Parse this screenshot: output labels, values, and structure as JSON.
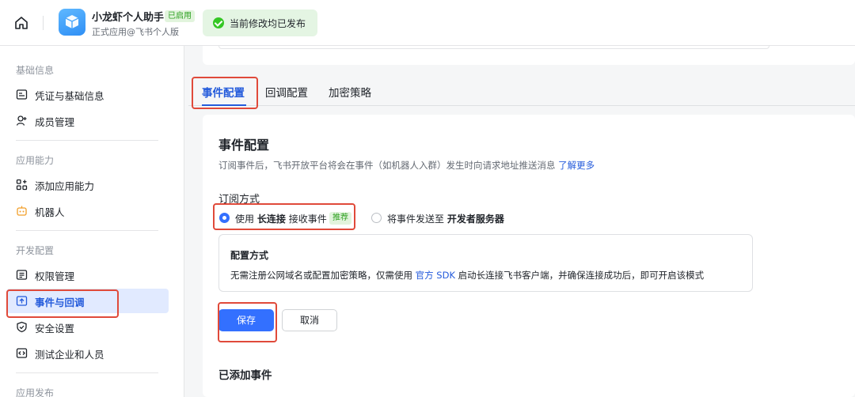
{
  "header": {
    "app_name": "小龙虾个人助手",
    "app_tag": "已启用",
    "app_subtitle": "正式应用@飞书个人版",
    "toast": "当前修改均已发布"
  },
  "sidebar": {
    "groups": [
      {
        "title": "基础信息",
        "items": [
          {
            "label": "凭证与基础信息"
          },
          {
            "label": "成员管理"
          }
        ]
      },
      {
        "title": "应用能力",
        "items": [
          {
            "label": "添加应用能力"
          },
          {
            "label": "机器人"
          }
        ]
      },
      {
        "title": "开发配置",
        "items": [
          {
            "label": "权限管理"
          },
          {
            "label": "事件与回调"
          },
          {
            "label": "安全设置"
          },
          {
            "label": "测试企业和人员"
          }
        ]
      },
      {
        "title": "应用发布",
        "items": []
      }
    ],
    "active_item": "事件与回调"
  },
  "tabs": [
    {
      "label": "事件配置",
      "active": true
    },
    {
      "label": "回调配置",
      "active": false
    },
    {
      "label": "加密策略",
      "active": false
    }
  ],
  "event_config": {
    "title": "事件配置",
    "description": "订阅事件后，飞书开放平台将会在事件（如机器人入群）发生时向请求地址推送消息",
    "learn_more": "了解更多",
    "subscribe_title": "订阅方式",
    "option1": {
      "prefix": "使用",
      "bold": "长连接",
      "suffix": "接收事件",
      "badge": "推荐",
      "checked": true
    },
    "option2": {
      "prefix": "将事件发送至",
      "bold": "开发者服务器",
      "checked": false
    },
    "mode_title": "配置方式",
    "mode_desc_prefix": "无需注册公网域名或配置加密策略，仅需使用",
    "mode_link": "官方 SDK",
    "mode_desc_suffix": "启动长连接飞书客户端，并确保连接成功后，即可开启该模式",
    "save_button": "保存",
    "cancel_button": "取消",
    "added_events_title": "已添加事件"
  },
  "colors": {
    "accent": "#3370ff",
    "highlight": "#e04a3a",
    "success": "#34c724"
  }
}
